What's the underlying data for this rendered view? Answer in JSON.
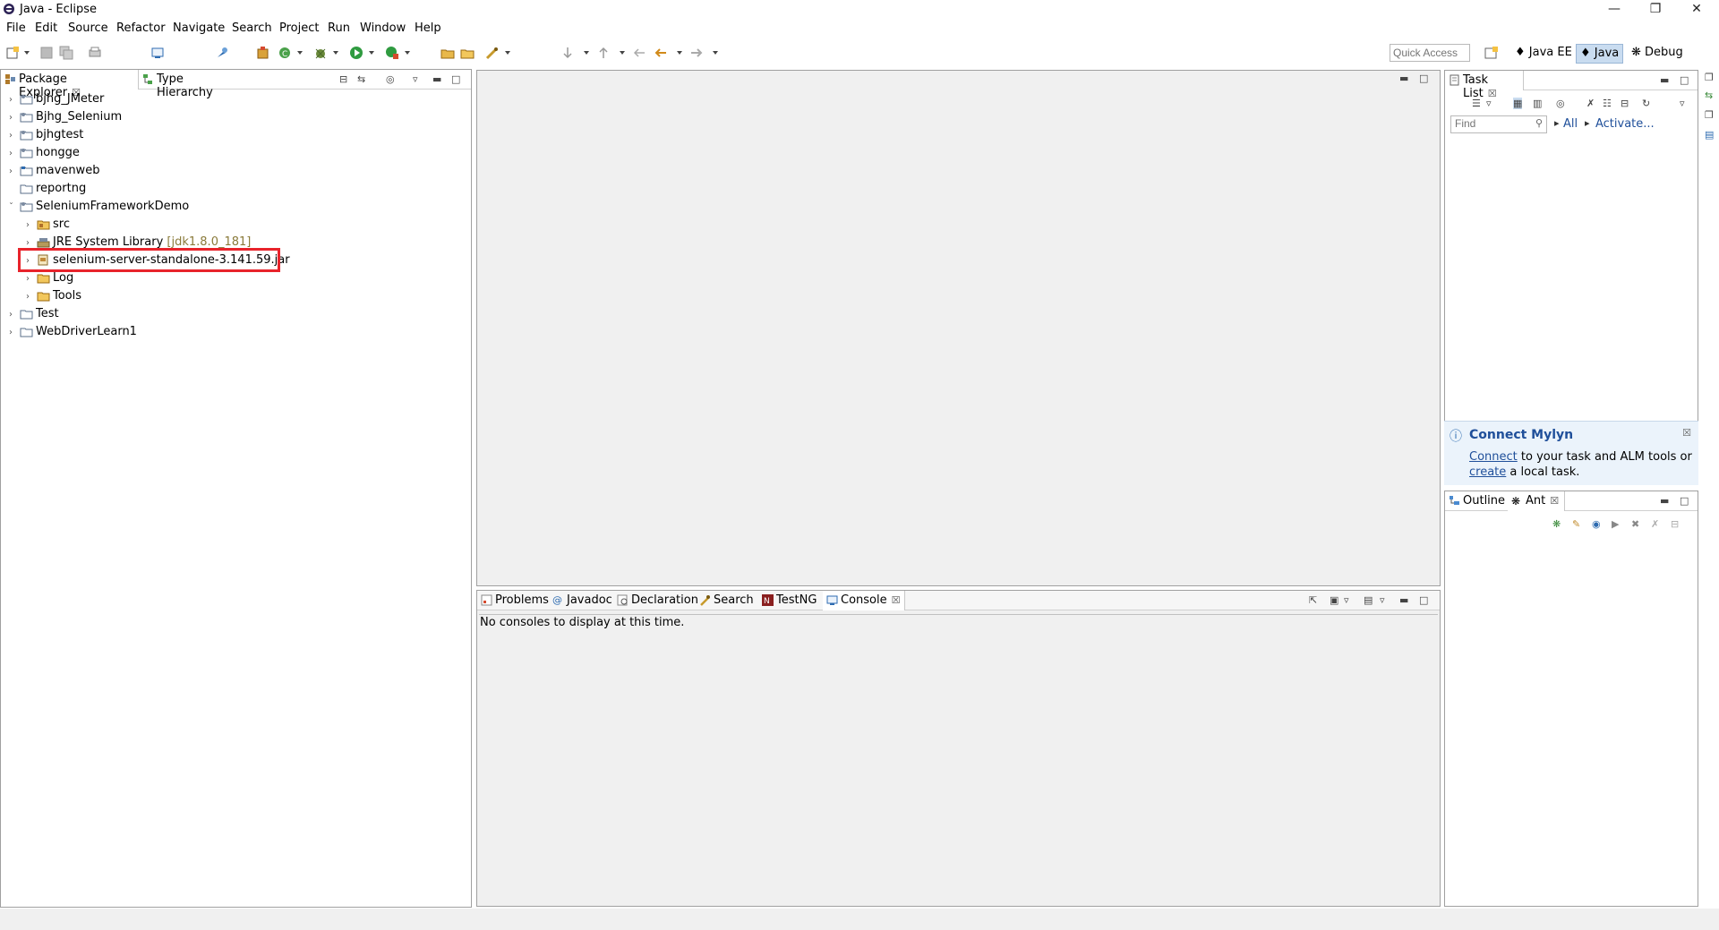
{
  "window": {
    "title": "Java - Eclipse",
    "minimize_icon": "minimize-icon",
    "maximize_icon": "restore-icon",
    "close_icon": "close-icon"
  },
  "menu": [
    "File",
    "Edit",
    "Source",
    "Refactor",
    "Navigate",
    "Search",
    "Project",
    "Run",
    "Window",
    "Help"
  ],
  "toolbar": {
    "quick_access_placeholder": "Quick Access",
    "perspectives": [
      {
        "label": "Java EE",
        "icon": "javaee-perspective-icon",
        "active": false
      },
      {
        "label": "Java",
        "icon": "java-perspective-icon",
        "active": true
      },
      {
        "label": "Debug",
        "icon": "debug-perspective-icon",
        "active": false
      }
    ]
  },
  "package_explorer": {
    "tabs": [
      {
        "label": "Package Explorer",
        "icon": "package-explorer-icon",
        "active": true
      },
      {
        "label": "Type Hierarchy",
        "icon": "type-hierarchy-icon",
        "active": false
      }
    ],
    "tree": [
      {
        "label": "bjhg_JMeter",
        "depth": 0,
        "expanded": false,
        "icon": "project-icon"
      },
      {
        "label": "Bjhg_Selenium",
        "depth": 0,
        "expanded": false,
        "icon": "project-icon"
      },
      {
        "label": "bjhgtest",
        "depth": 0,
        "expanded": false,
        "icon": "project-icon"
      },
      {
        "label": "hongge",
        "depth": 0,
        "expanded": false,
        "icon": "project-icon"
      },
      {
        "label": "mavenweb",
        "depth": 0,
        "expanded": false,
        "icon": "project-icon"
      },
      {
        "label": "reportng",
        "depth": 0,
        "expanded": null,
        "icon": "project-icon"
      },
      {
        "label": "SeleniumFrameworkDemo",
        "depth": 0,
        "expanded": true,
        "icon": "project-open-icon"
      },
      {
        "label": "src",
        "depth": 1,
        "expanded": false,
        "icon": "source-folder-icon"
      },
      {
        "label": "JRE System Library",
        "decoration": "[jdk1.8.0_181]",
        "depth": 1,
        "expanded": false,
        "icon": "library-icon"
      },
      {
        "label": "selenium-server-standalone-3.141.59.jar",
        "depth": 1,
        "expanded": false,
        "icon": "jar-icon",
        "highlighted": true
      },
      {
        "label": "Log",
        "depth": 1,
        "expanded": false,
        "icon": "folder-icon"
      },
      {
        "label": "Tools",
        "depth": 1,
        "expanded": false,
        "icon": "folder-icon"
      },
      {
        "label": "Test",
        "depth": 0,
        "expanded": false,
        "icon": "project-icon"
      },
      {
        "label": "WebDriverLearn1",
        "depth": 0,
        "expanded": false,
        "icon": "project-icon"
      }
    ]
  },
  "console_view": {
    "tabs": [
      {
        "label": "Problems",
        "icon": "problems-icon",
        "active": false
      },
      {
        "label": "Javadoc",
        "icon": "javadoc-icon",
        "active": false
      },
      {
        "label": "Declaration",
        "icon": "declaration-icon",
        "active": false
      },
      {
        "label": "Search",
        "icon": "search-icon",
        "active": false
      },
      {
        "label": "TestNG",
        "icon": "testng-icon",
        "active": false
      },
      {
        "label": "Console",
        "icon": "console-icon",
        "active": true
      }
    ],
    "message": "No consoles to display at this time."
  },
  "task_list": {
    "tab": "Task List",
    "find_placeholder": "Find",
    "all_label": "All",
    "activate_label": "Activate..."
  },
  "mylyn": {
    "title": "Connect Mylyn",
    "connect_link": "Connect",
    "text1": " to your task and ALM tools or",
    "create_link": "create",
    "text2": " a local task."
  },
  "outline": {
    "tabs": [
      {
        "label": "Outline",
        "icon": "outline-icon",
        "active": false
      },
      {
        "label": "Ant",
        "icon": "ant-icon",
        "active": true
      }
    ]
  }
}
